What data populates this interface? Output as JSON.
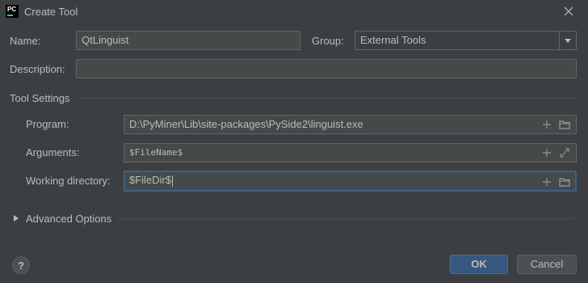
{
  "window": {
    "title": "Create Tool",
    "app_icon_text": "PC"
  },
  "form": {
    "name_label": "Name:",
    "name_value": "QtLinguist",
    "group_label": "Group:",
    "group_value": "External Tools",
    "description_label": "Description:",
    "description_value": ""
  },
  "tool_settings": {
    "section_label": "Tool Settings",
    "program_label": "Program:",
    "program_value": "D:\\PyMiner\\Lib\\site-packages\\PySide2\\linguist.exe",
    "arguments_label": "Arguments:",
    "arguments_value": "$FileName$",
    "working_dir_label": "Working directory:",
    "working_dir_value": "$FileDir$"
  },
  "advanced": {
    "label": "Advanced Options"
  },
  "buttons": {
    "help_label": "?",
    "ok_label": "OK",
    "cancel_label": "Cancel"
  },
  "colors": {
    "background": "#3c3f41",
    "field_background": "#45494a",
    "focus_border": "#3d6185",
    "ok_button": "#365880"
  }
}
